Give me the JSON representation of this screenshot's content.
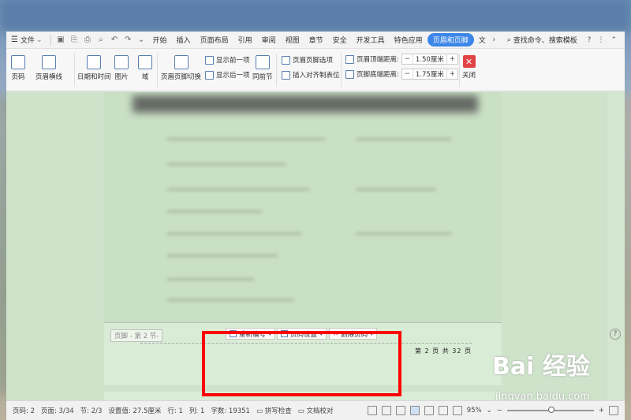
{
  "menubar": {
    "file_label": "文件",
    "tabs": [
      "开始",
      "插入",
      "页面布局",
      "引用",
      "审阅",
      "视图",
      "章节",
      "安全",
      "开发工具",
      "特色应用",
      "页眉和页脚",
      "文"
    ],
    "active_tab": "页眉和页脚",
    "search_label": "查找命令、搜索模板"
  },
  "ribbon": {
    "page_number": "页码",
    "header_line": "页眉横线",
    "date_time": "日期和时间",
    "picture": "图片",
    "field": "域",
    "switch_header_footer": "页眉页脚切换",
    "show_prev": "显示前一项",
    "show_next": "显示后一项",
    "same_as_prev": "同前节",
    "hf_options": "页眉页脚选项",
    "insert_align_tab": "插入对齐制表位",
    "header_top_label": "页眉顶端距离:",
    "header_top_value": "1.50厘米",
    "footer_bottom_label": "页脚底端距离:",
    "footer_bottom_value": "1.75厘米",
    "close": "关闭"
  },
  "document": {
    "footer_tag": "页脚 - 第 2 节-",
    "renumber": "重新编号",
    "page_num_settings": "页码设置",
    "delete_page_num": "删除页码",
    "page_number_text": "第 2 页 共 32 页"
  },
  "status": {
    "page_code": "页码: 2",
    "page": "页面: 3/34",
    "section": "节: 2/3",
    "setting": "设置值: 27.5厘米",
    "row": "行: 1",
    "col": "列: 1",
    "word_count": "字数: 19351",
    "spell_check": "拼写检查",
    "doc_proof": "文档校对",
    "zoom": "95%"
  },
  "watermark": {
    "brand": "Bai 经验",
    "url": "jingyan.baidu.com"
  },
  "colors": {
    "accent": "#3b86e7",
    "highlight": "#ff0000",
    "doc_bg": "#cfe3cb"
  }
}
